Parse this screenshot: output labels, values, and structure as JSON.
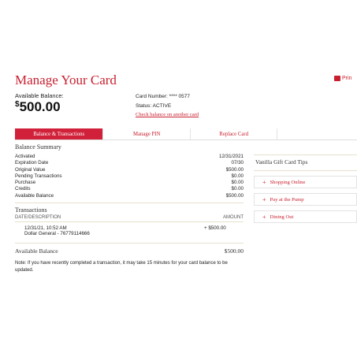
{
  "page": {
    "title": "Manage Your Card",
    "print_label": "Prin"
  },
  "balance": {
    "label": "Available Balance:",
    "currency": "$",
    "amount": "500.00"
  },
  "card": {
    "number": "Card Number: **** 0577",
    "status": "Status: ACTIVE",
    "check_link": "Check balance on another card"
  },
  "tabs": [
    {
      "label": "Balance & Transactions",
      "active": true
    },
    {
      "label": "Manage PIN",
      "active": false
    },
    {
      "label": "Replace Card",
      "active": false
    }
  ],
  "summary": {
    "heading": "Balance Summary",
    "rows": [
      {
        "label": "Activated",
        "value": "12/31/2021"
      },
      {
        "label": "Expiration Date",
        "value": "07/30"
      },
      {
        "label": "Original Value",
        "value": "$500.00"
      },
      {
        "label": "Pending Transactions",
        "value": "$0.00"
      },
      {
        "label": "Purchase",
        "value": "$0.00"
      },
      {
        "label": "Credits",
        "value": "$0.00"
      },
      {
        "label": "Available Balance",
        "value": "$500.00"
      }
    ]
  },
  "transactions": {
    "heading": "Transactions",
    "col_date": "DATE/DESCRIPTION",
    "col_amount": "AMOUNT",
    "items": [
      {
        "date": "12/31/21, 10:52 AM",
        "description": "Dollar General - 76779114666",
        "amount": "+ $500.00"
      }
    ]
  },
  "available": {
    "label": "Available Balance",
    "value": "$500.00"
  },
  "note": "Note: If you have recently completed a transaction, it may take 15 minutes for your card balance to be updated.",
  "tips": {
    "title": "Vanilla Gift Card Tips",
    "items": [
      "Shopping Online",
      "Pay at the Pump",
      "Dining Out"
    ]
  },
  "colors": {
    "accent": "#c8202f",
    "tab_active": "#d1213a"
  }
}
